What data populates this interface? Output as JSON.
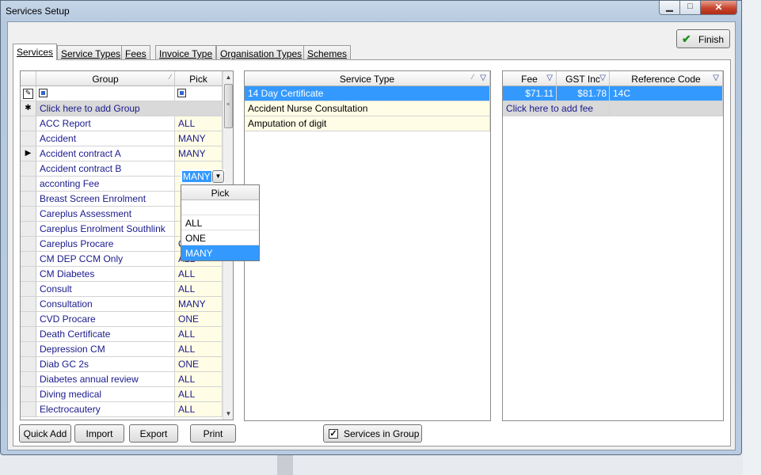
{
  "window": {
    "title": "Services Setup",
    "min_glyph": "▁",
    "max_glyph": "□",
    "close_glyph": "✕"
  },
  "finish_label": "Finish",
  "tabs": [
    "Services",
    "Service Types",
    "Fees",
    "Invoice Type",
    "Organisation Types",
    "Schemes"
  ],
  "group_grid": {
    "headers": {
      "group": "Group",
      "pick": "Pick"
    },
    "add_row": "Click here to add Group",
    "rows": [
      {
        "group": "ACC Report",
        "pick": "ALL"
      },
      {
        "group": "Accident",
        "pick": "MANY"
      },
      {
        "group": "Accident contract A",
        "pick": "MANY"
      },
      {
        "group": "Accident contract B",
        "pick": ""
      },
      {
        "group": "acconting Fee",
        "pick": ""
      },
      {
        "group": "Breast Screen Enrolment",
        "pick": ""
      },
      {
        "group": "Careplus Assessment",
        "pick": ""
      },
      {
        "group": "Careplus Enrolment Southlink",
        "pick": ""
      },
      {
        "group": "Careplus Procare",
        "pick": "ONE"
      },
      {
        "group": "CM DEP CCM Only",
        "pick": "ALL"
      },
      {
        "group": "CM Diabetes",
        "pick": "ALL"
      },
      {
        "group": "Consult",
        "pick": "ALL"
      },
      {
        "group": "Consultation",
        "pick": "MANY"
      },
      {
        "group": "CVD Procare",
        "pick": "ONE"
      },
      {
        "group": "Death Certificate",
        "pick": "ALL"
      },
      {
        "group": "Depression CM",
        "pick": "ALL"
      },
      {
        "group": "Diab GC 2s",
        "pick": "ONE"
      },
      {
        "group": "Diabetes annual review",
        "pick": "ALL"
      },
      {
        "group": "Diving medical",
        "pick": "ALL"
      },
      {
        "group": "Electrocautery",
        "pick": "ALL"
      }
    ],
    "current_pick": "MANY",
    "dropdown": {
      "header": "Pick",
      "options": [
        "",
        "ALL",
        "ONE",
        "MANY"
      ],
      "selected": "MANY"
    }
  },
  "service_grid": {
    "header": "Service Type",
    "rows": [
      "14 Day Certificate",
      "Accident Nurse Consultation",
      "Amputation of digit"
    ]
  },
  "fee_grid": {
    "headers": {
      "fee": "Fee",
      "gst": "GST Inc",
      "ref": "Reference Code"
    },
    "rows": [
      {
        "fee": "$71.11",
        "gst": "$81.78",
        "ref": "14C"
      }
    ],
    "add_row": "Click here to add fee"
  },
  "buttons": {
    "quick_add": "Quick Add",
    "import": "Import",
    "export": "Export",
    "print": "Print"
  },
  "services_in_group": {
    "label": "Services in Group",
    "checked": true
  }
}
